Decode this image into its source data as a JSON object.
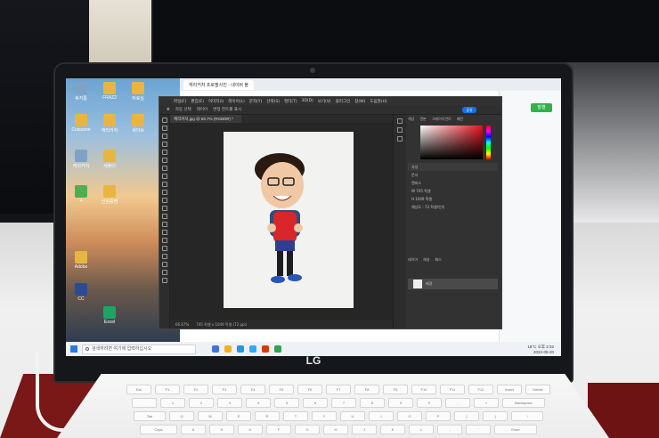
{
  "photo": {
    "subject": "LG laptop on a desk displaying Photoshop with a caricature image",
    "brand_logo": "LG"
  },
  "browser": {
    "tab_title": "캐리커처 프로필사진 - 네이버 블",
    "publish_button": "발행"
  },
  "desktop_icons": [
    {
      "label": "휴지통",
      "color": "#7fa3c8"
    },
    {
      "label": "FRAZ2",
      "color": "#e8b640"
    },
    {
      "label": "자료실",
      "color": "#e8b640"
    },
    {
      "label": "Cutscene",
      "color": "#e8b640"
    },
    {
      "label": "캐리커처",
      "color": "#e8b640"
    },
    {
      "label": "세이브",
      "color": "#e8b640"
    },
    {
      "label": "캐리커처",
      "color": "#7fa3c8"
    },
    {
      "label": "새폴더",
      "color": "#e8b640"
    },
    {
      "label": "4",
      "color": "#4caf50"
    },
    {
      "label": "신원증명",
      "color": "#e8b640"
    },
    {
      "label": "Adobe",
      "color": "#e8b640"
    },
    {
      "label": "CC",
      "color": "#2c4a9a"
    },
    {
      "label": "Excel",
      "color": "#21a366"
    }
  ],
  "photoshop": {
    "menu": [
      "파일(F)",
      "편집(E)",
      "이미지(I)",
      "레이어(L)",
      "문자(Y)",
      "선택(S)",
      "필터(T)",
      "3D(D)",
      "보기(V)",
      "플러그인",
      "창(W)",
      "도움말(H)"
    ],
    "options": [
      "자동 선택",
      "레이어",
      "변형 컨트롤 표시"
    ],
    "share_label": "공유",
    "doc_tab": "캐리커처.jpg @ 66.7% (RGB/8#) *",
    "status_zoom": "66.67%",
    "status_size": "745 픽셀 x 1049 픽셀 (72 ppi)",
    "panel_tabs": [
      "색상",
      "견본",
      "그레이디언트",
      "패턴"
    ],
    "properties_title": "속성",
    "properties_rows": [
      "문서",
      "캔버스",
      "W  745 픽셀",
      "H  1049 픽셀",
      "해상도 : 72 픽셀/인치"
    ],
    "layers_tabs": [
      "레이어",
      "채널",
      "패스"
    ],
    "layer_name": "배경"
  },
  "taskbar": {
    "search_placeholder": "검색하려면 여기에 입력하십시오",
    "weather": "18°C",
    "time": "오후 2:32",
    "date": "2022-05-20"
  },
  "keyboard": {
    "rows": [
      [
        "Esc",
        "F1",
        "F2",
        "F3",
        "F4",
        "F5",
        "F6",
        "F7",
        "F8",
        "F9",
        "F10",
        "F11",
        "F12",
        "Insert",
        "Delete"
      ],
      [
        "`",
        "1",
        "2",
        "3",
        "4",
        "5",
        "6",
        "7",
        "8",
        "9",
        "0",
        "-",
        "=",
        "Backspace"
      ],
      [
        "Tab",
        "Q",
        "W",
        "E",
        "R",
        "T",
        "Y",
        "U",
        "I",
        "O",
        "P",
        "[",
        "]",
        "\\"
      ],
      [
        "Caps",
        "A",
        "S",
        "D",
        "F",
        "G",
        "H",
        "J",
        "K",
        "L",
        ";",
        "'",
        "Enter"
      ]
    ]
  }
}
